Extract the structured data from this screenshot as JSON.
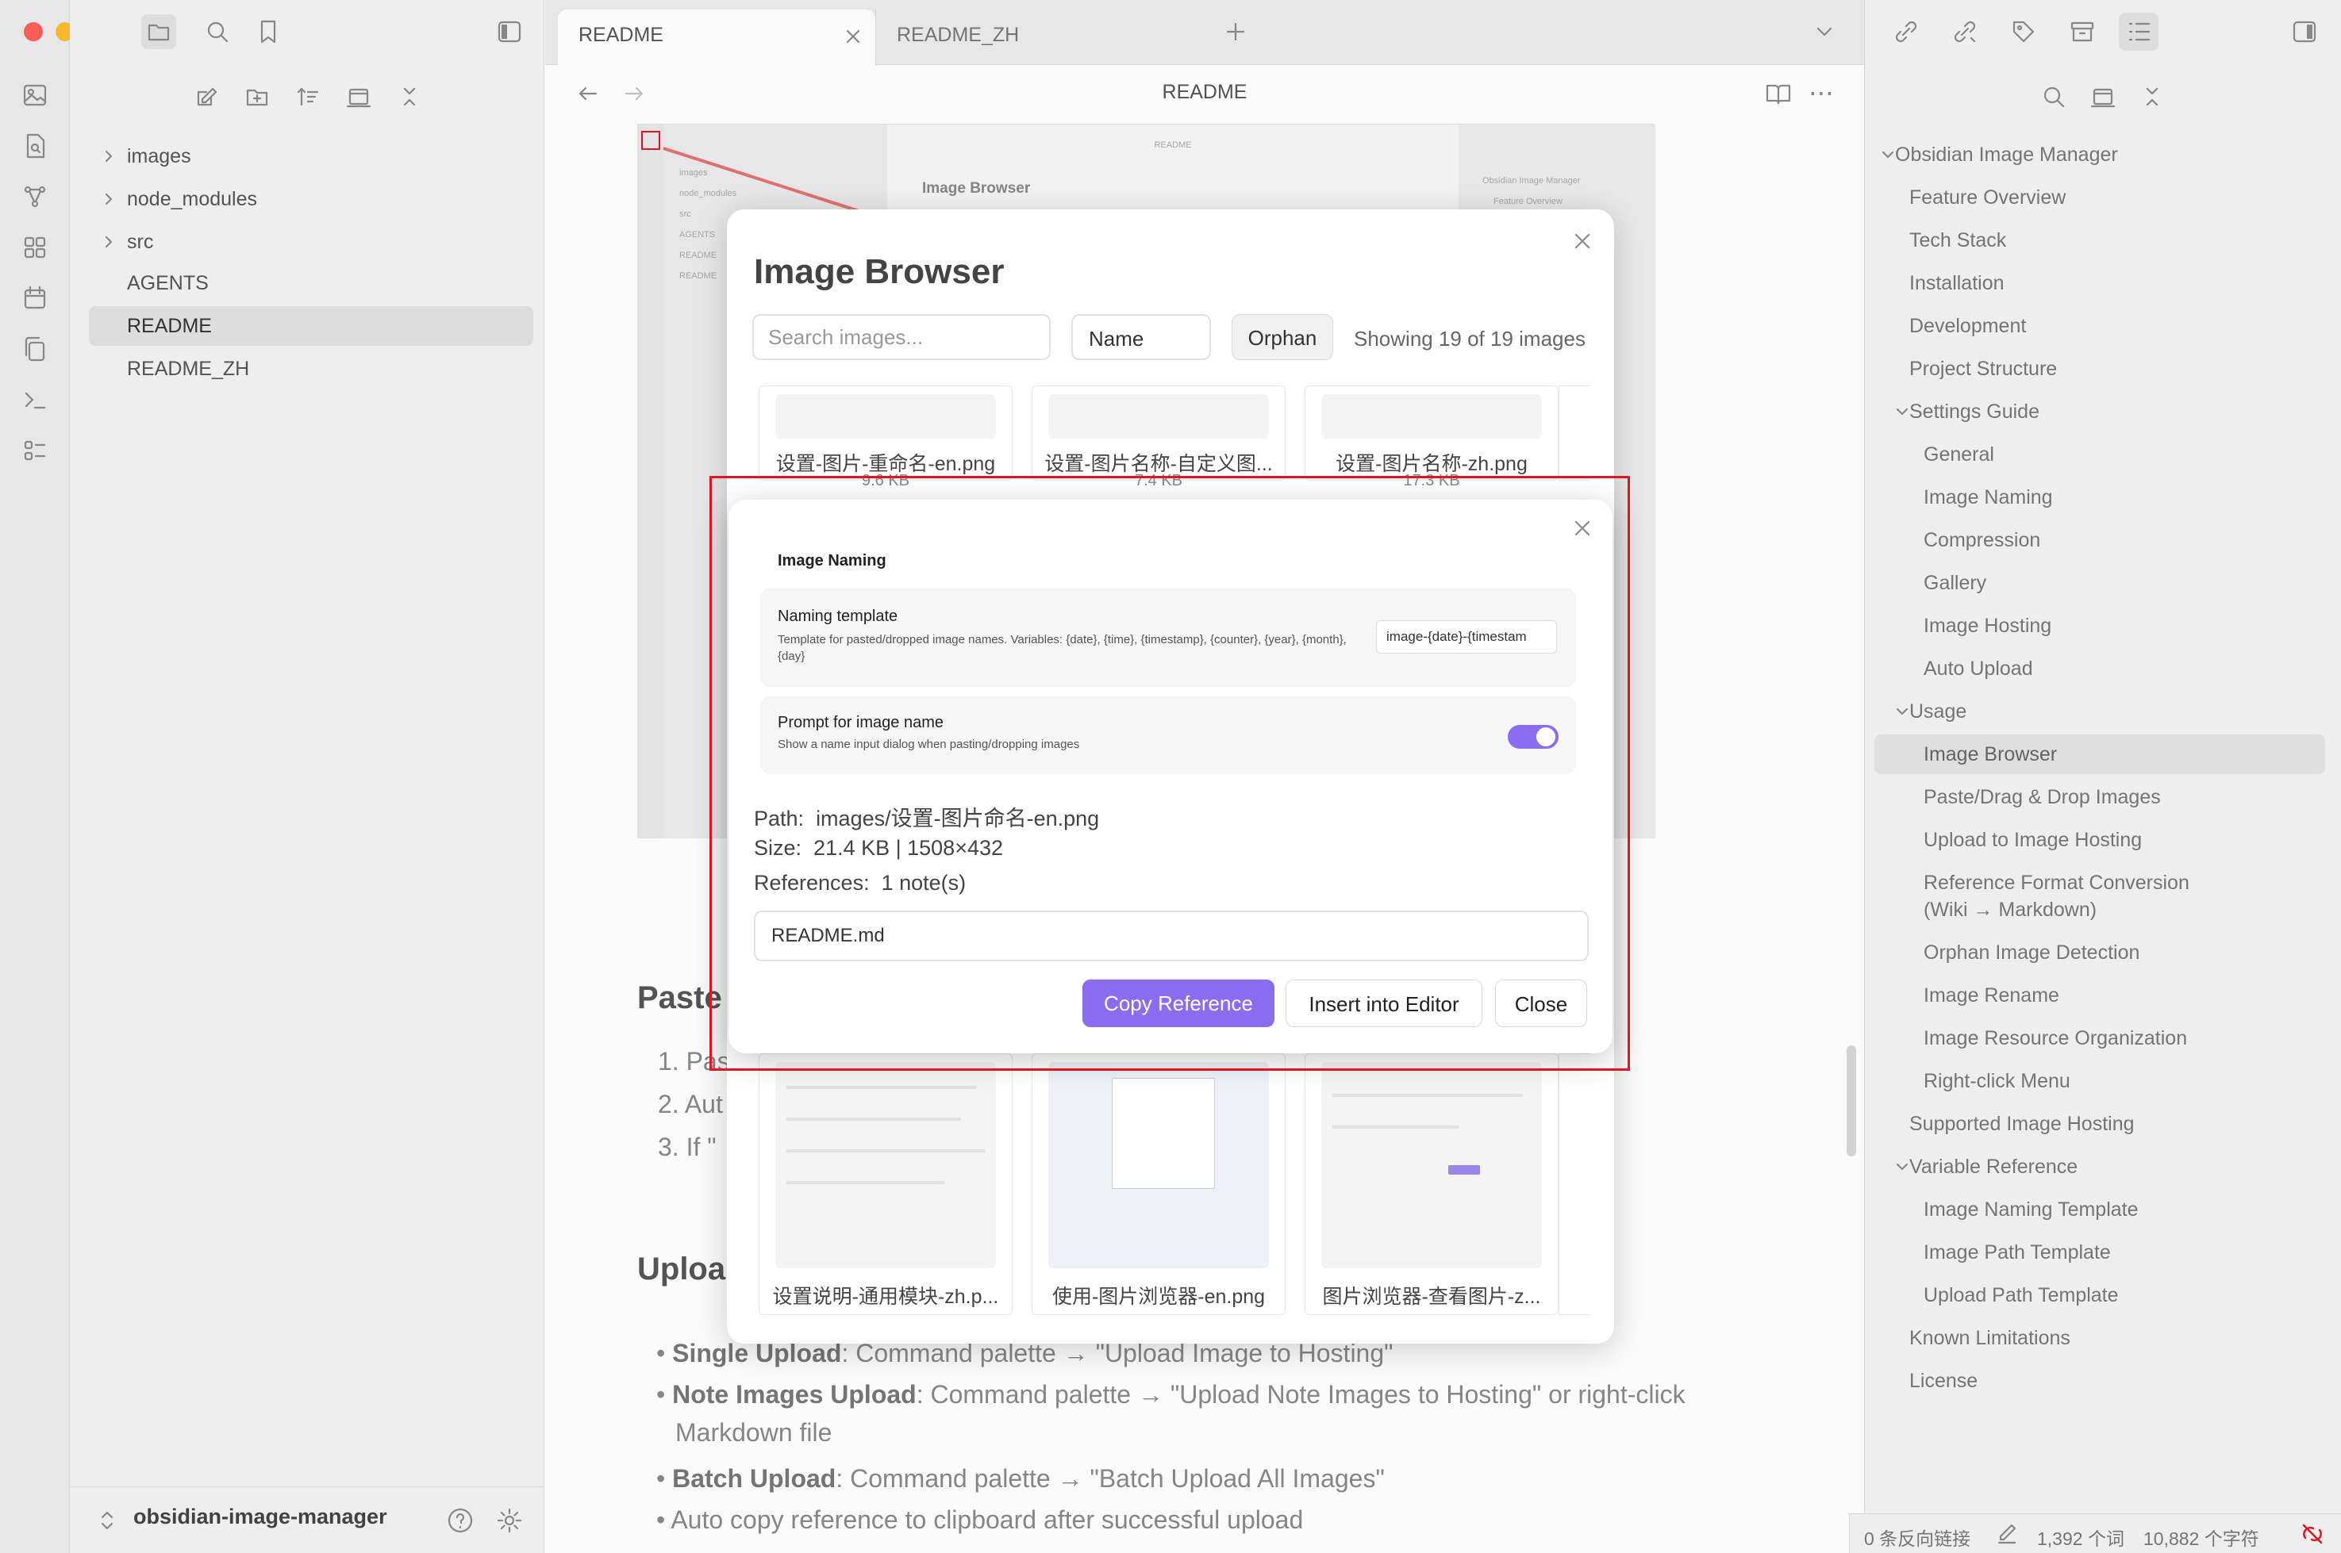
{
  "window": {
    "traffic_lights": [
      "#ff5f57",
      "#febc2e",
      "#28c840"
    ]
  },
  "file_explorer": {
    "items": [
      {
        "label": "images",
        "folder": true
      },
      {
        "label": "node_modules",
        "folder": true
      },
      {
        "label": "src",
        "folder": true
      },
      {
        "label": "AGENTS",
        "folder": false
      },
      {
        "label": "README",
        "folder": false,
        "active": true
      },
      {
        "label": "README_ZH",
        "folder": false
      }
    ],
    "vault_name": "obsidian-image-manager"
  },
  "tabs": [
    {
      "label": "README",
      "active": true
    },
    {
      "label": "README_ZH",
      "active": false
    }
  ],
  "view_header": {
    "title": "README"
  },
  "content": {
    "heading_paste": "Paste",
    "list_paste": [
      "1. Pas",
      "2. Aut",
      "3. If \""
    ],
    "heading_upload": "Uploa",
    "bullets": [
      {
        "bold": "Single Upload",
        "text": ": Command palette → \"Upload Image to Hosting\""
      },
      {
        "bold": "Note Images Upload",
        "text": ": Command palette → \"Upload Note Images to Hosting\" or right-click"
      },
      {
        "bold": "",
        "text": "Markdown file"
      },
      {
        "bold": "Batch Upload",
        "text": ": Command palette → \"Batch Upload All Images\""
      },
      {
        "bold": "",
        "text": "Auto copy reference to clipboard after successful upload"
      }
    ]
  },
  "outline": {
    "title": "Obsidian Image Manager",
    "items": [
      {
        "label": "Feature Overview",
        "level": 1
      },
      {
        "label": "Tech Stack",
        "level": 1
      },
      {
        "label": "Installation",
        "level": 1
      },
      {
        "label": "Development",
        "level": 1
      },
      {
        "label": "Project Structure",
        "level": 1
      },
      {
        "label": "Settings Guide",
        "level": 1,
        "collapsible": true
      },
      {
        "label": "General",
        "level": 2
      },
      {
        "label": "Image Naming",
        "level": 2
      },
      {
        "label": "Compression",
        "level": 2
      },
      {
        "label": "Gallery",
        "level": 2
      },
      {
        "label": "Image Hosting",
        "level": 2
      },
      {
        "label": "Auto Upload",
        "level": 2
      },
      {
        "label": "Usage",
        "level": 1,
        "collapsible": true
      },
      {
        "label": "Image Browser",
        "level": 2,
        "active": true
      },
      {
        "label": "Paste/Drag & Drop Images",
        "level": 2
      },
      {
        "label": "Upload to Image Hosting",
        "level": 2
      },
      {
        "label": "Reference Format Conversion",
        "level": 2,
        "line2": "(Wiki → Markdown)"
      },
      {
        "label": "Orphan Image Detection",
        "level": 2
      },
      {
        "label": "Image Rename",
        "level": 2
      },
      {
        "label": "Image Resource Organization",
        "level": 2
      },
      {
        "label": "Right-click Menu",
        "level": 2
      },
      {
        "label": "Supported Image Hosting",
        "level": 1
      },
      {
        "label": "Variable Reference",
        "level": 1,
        "collapsible": true
      },
      {
        "label": "Image Naming Template",
        "level": 2
      },
      {
        "label": "Image Path Template",
        "level": 2
      },
      {
        "label": "Upload Path Template",
        "level": 2
      },
      {
        "label": "Known Limitations",
        "level": 1
      },
      {
        "label": "License",
        "level": 1
      }
    ]
  },
  "status_bar": {
    "backlinks": "0 条反向链接",
    "words": "1,392 个词",
    "chars": "10,882 个字符"
  },
  "image_browser": {
    "title": "Image Browser",
    "search_placeholder": "Search images...",
    "sort_label": "Name",
    "orphan_label": "Orphan",
    "count_text": "Showing 19 of 19 images",
    "top_cards": [
      {
        "name": "设置-图片-重命名-en.png",
        "size": "9.6 KB"
      },
      {
        "name": "设置-图片名称-自定义图...",
        "size": "7.4 KB"
      },
      {
        "name": "设置-图片名称-zh.png",
        "size": "17.3 KB"
      }
    ],
    "bottom_cards": [
      {
        "name": "设置说明-通用模块-zh.p..."
      },
      {
        "name": "使用-图片浏览器-en.png"
      },
      {
        "name": "图片浏览器-查看图片-z..."
      }
    ]
  },
  "background_screenshot": {
    "panel_title": "Image Browser",
    "header": "README",
    "tree": [
      "images",
      "node_modules",
      "src",
      "AGENTS",
      "README",
      "README"
    ],
    "outline": [
      "Obsidian Image Manager",
      "Feature Overview"
    ]
  },
  "detail_modal": {
    "section_title": "Image Naming",
    "setting1": {
      "name": "Naming template",
      "desc": "Template for pasted/dropped image names. Variables: {date}, {time}, {timestamp}, {counter}, {year}, {month}, {day}",
      "value": "image-{date}-{timestam"
    },
    "setting2": {
      "name": "Prompt for image name",
      "desc": "Show a name input dialog when pasting/dropping images",
      "enabled": true
    },
    "path_label": "Path:",
    "path_value": "images/设置-图片命名-en.png",
    "size_label": "Size:",
    "size_value": "21.4 KB | 1508×432",
    "refs_label": "References:",
    "refs_value": "1 note(s)",
    "ref_note": "README.md",
    "copy_label": "Copy Reference",
    "insert_label": "Insert into Editor",
    "close_label": "Close",
    "accent": "#8a6cf0",
    "highlight": "#e0161e"
  }
}
